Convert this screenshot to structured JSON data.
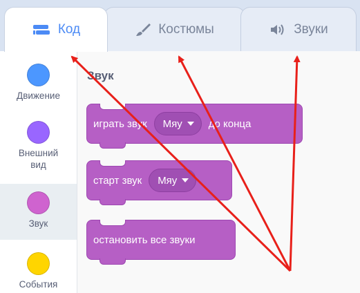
{
  "tabs": [
    {
      "label": "Код",
      "icon": "code-icon",
      "active": true
    },
    {
      "label": "Костюмы",
      "icon": "brush-icon",
      "active": false
    },
    {
      "label": "Звуки",
      "icon": "speaker-icon",
      "active": false
    }
  ],
  "categories": [
    {
      "label": "Движение",
      "color": "#4c97ff"
    },
    {
      "label": "Внешний вид",
      "color": "#9966ff"
    },
    {
      "label": "Звук",
      "color": "#cf63cf",
      "selected": true
    },
    {
      "label": "События",
      "color": "#ffd500"
    }
  ],
  "workspace": {
    "title": "Звук",
    "blocks": [
      {
        "text_before": "играть звук",
        "dropdown": "Мяу",
        "text_after": "до конца"
      },
      {
        "text_before": "старт звук",
        "dropdown": "Мяу"
      },
      {
        "text_before": "остановить все звуки"
      }
    ]
  },
  "colors": {
    "active_tab_text": "#4c8bf5",
    "sound_block": "#b65fc5",
    "arrow": "#e8201a"
  }
}
